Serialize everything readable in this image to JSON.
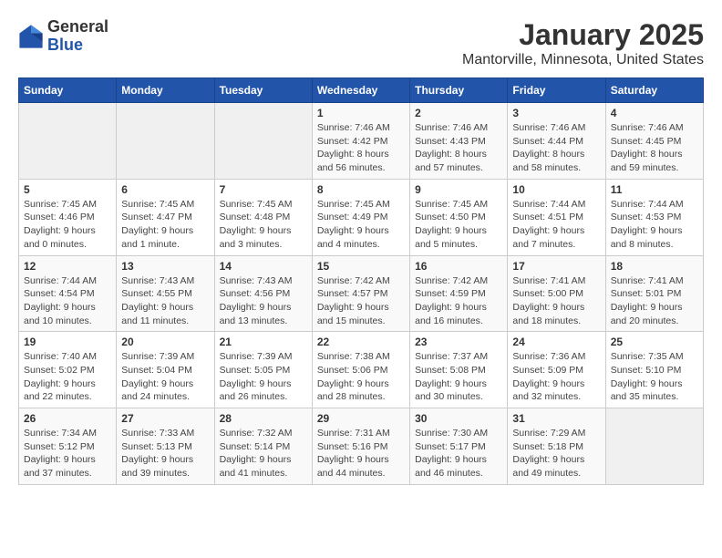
{
  "header": {
    "logo_general": "General",
    "logo_blue": "Blue",
    "title": "January 2025",
    "subtitle": "Mantorville, Minnesota, United States"
  },
  "days_of_week": [
    "Sunday",
    "Monday",
    "Tuesday",
    "Wednesday",
    "Thursday",
    "Friday",
    "Saturday"
  ],
  "weeks": [
    [
      {
        "day": "",
        "info": ""
      },
      {
        "day": "",
        "info": ""
      },
      {
        "day": "",
        "info": ""
      },
      {
        "day": "1",
        "info": "Sunrise: 7:46 AM\nSunset: 4:42 PM\nDaylight: 8 hours and 56 minutes."
      },
      {
        "day": "2",
        "info": "Sunrise: 7:46 AM\nSunset: 4:43 PM\nDaylight: 8 hours and 57 minutes."
      },
      {
        "day": "3",
        "info": "Sunrise: 7:46 AM\nSunset: 4:44 PM\nDaylight: 8 hours and 58 minutes."
      },
      {
        "day": "4",
        "info": "Sunrise: 7:46 AM\nSunset: 4:45 PM\nDaylight: 8 hours and 59 minutes."
      }
    ],
    [
      {
        "day": "5",
        "info": "Sunrise: 7:45 AM\nSunset: 4:46 PM\nDaylight: 9 hours and 0 minutes."
      },
      {
        "day": "6",
        "info": "Sunrise: 7:45 AM\nSunset: 4:47 PM\nDaylight: 9 hours and 1 minute."
      },
      {
        "day": "7",
        "info": "Sunrise: 7:45 AM\nSunset: 4:48 PM\nDaylight: 9 hours and 3 minutes."
      },
      {
        "day": "8",
        "info": "Sunrise: 7:45 AM\nSunset: 4:49 PM\nDaylight: 9 hours and 4 minutes."
      },
      {
        "day": "9",
        "info": "Sunrise: 7:45 AM\nSunset: 4:50 PM\nDaylight: 9 hours and 5 minutes."
      },
      {
        "day": "10",
        "info": "Sunrise: 7:44 AM\nSunset: 4:51 PM\nDaylight: 9 hours and 7 minutes."
      },
      {
        "day": "11",
        "info": "Sunrise: 7:44 AM\nSunset: 4:53 PM\nDaylight: 9 hours and 8 minutes."
      }
    ],
    [
      {
        "day": "12",
        "info": "Sunrise: 7:44 AM\nSunset: 4:54 PM\nDaylight: 9 hours and 10 minutes."
      },
      {
        "day": "13",
        "info": "Sunrise: 7:43 AM\nSunset: 4:55 PM\nDaylight: 9 hours and 11 minutes."
      },
      {
        "day": "14",
        "info": "Sunrise: 7:43 AM\nSunset: 4:56 PM\nDaylight: 9 hours and 13 minutes."
      },
      {
        "day": "15",
        "info": "Sunrise: 7:42 AM\nSunset: 4:57 PM\nDaylight: 9 hours and 15 minutes."
      },
      {
        "day": "16",
        "info": "Sunrise: 7:42 AM\nSunset: 4:59 PM\nDaylight: 9 hours and 16 minutes."
      },
      {
        "day": "17",
        "info": "Sunrise: 7:41 AM\nSunset: 5:00 PM\nDaylight: 9 hours and 18 minutes."
      },
      {
        "day": "18",
        "info": "Sunrise: 7:41 AM\nSunset: 5:01 PM\nDaylight: 9 hours and 20 minutes."
      }
    ],
    [
      {
        "day": "19",
        "info": "Sunrise: 7:40 AM\nSunset: 5:02 PM\nDaylight: 9 hours and 22 minutes."
      },
      {
        "day": "20",
        "info": "Sunrise: 7:39 AM\nSunset: 5:04 PM\nDaylight: 9 hours and 24 minutes."
      },
      {
        "day": "21",
        "info": "Sunrise: 7:39 AM\nSunset: 5:05 PM\nDaylight: 9 hours and 26 minutes."
      },
      {
        "day": "22",
        "info": "Sunrise: 7:38 AM\nSunset: 5:06 PM\nDaylight: 9 hours and 28 minutes."
      },
      {
        "day": "23",
        "info": "Sunrise: 7:37 AM\nSunset: 5:08 PM\nDaylight: 9 hours and 30 minutes."
      },
      {
        "day": "24",
        "info": "Sunrise: 7:36 AM\nSunset: 5:09 PM\nDaylight: 9 hours and 32 minutes."
      },
      {
        "day": "25",
        "info": "Sunrise: 7:35 AM\nSunset: 5:10 PM\nDaylight: 9 hours and 35 minutes."
      }
    ],
    [
      {
        "day": "26",
        "info": "Sunrise: 7:34 AM\nSunset: 5:12 PM\nDaylight: 9 hours and 37 minutes."
      },
      {
        "day": "27",
        "info": "Sunrise: 7:33 AM\nSunset: 5:13 PM\nDaylight: 9 hours and 39 minutes."
      },
      {
        "day": "28",
        "info": "Sunrise: 7:32 AM\nSunset: 5:14 PM\nDaylight: 9 hours and 41 minutes."
      },
      {
        "day": "29",
        "info": "Sunrise: 7:31 AM\nSunset: 5:16 PM\nDaylight: 9 hours and 44 minutes."
      },
      {
        "day": "30",
        "info": "Sunrise: 7:30 AM\nSunset: 5:17 PM\nDaylight: 9 hours and 46 minutes."
      },
      {
        "day": "31",
        "info": "Sunrise: 7:29 AM\nSunset: 5:18 PM\nDaylight: 9 hours and 49 minutes."
      },
      {
        "day": "",
        "info": ""
      }
    ]
  ]
}
